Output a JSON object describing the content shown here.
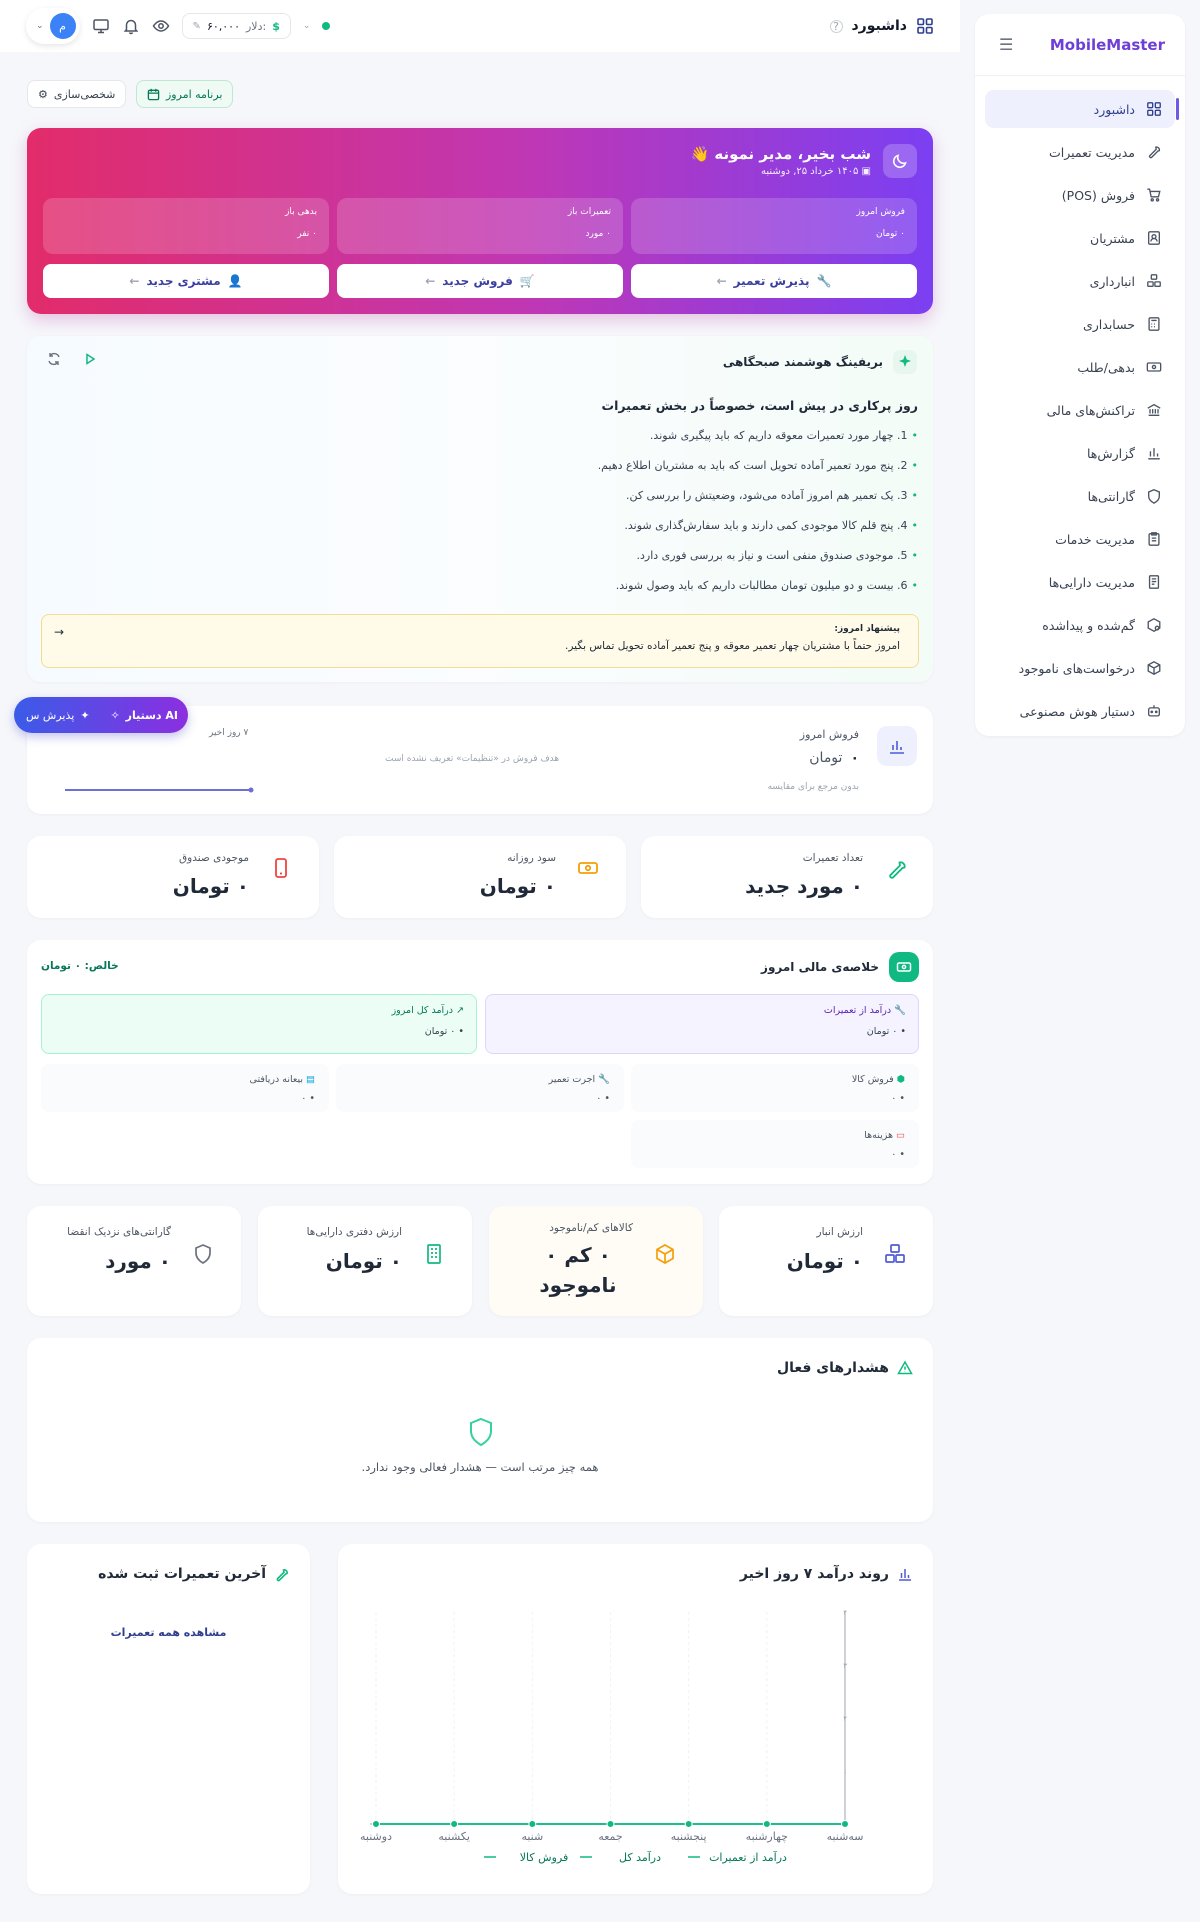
{
  "sidebar": {
    "brand": "MobileMaster",
    "items": [
      {
        "label": "داشبورد",
        "icon": "dashboard-icon",
        "active": true
      },
      {
        "label": "مدیریت تعمیرات",
        "icon": "wrench-icon"
      },
      {
        "label": "فروش (POS)",
        "icon": "cart-icon"
      },
      {
        "label": "مشتریان",
        "icon": "contacts-icon"
      },
      {
        "label": "انبارداری",
        "icon": "boxes-icon"
      },
      {
        "label": "حسابداری",
        "icon": "calculator-icon"
      },
      {
        "label": "بدهی/طلب",
        "icon": "money-icon"
      },
      {
        "label": "تراکنش‌های مالی",
        "icon": "bank-icon"
      },
      {
        "label": "گزارش‌ها",
        "icon": "report-icon"
      },
      {
        "label": "گارانتی‌ها",
        "icon": "shield-icon"
      },
      {
        "label": "مدیریت خدمات",
        "icon": "clipboard-icon"
      },
      {
        "label": "مدیریت دارایی‌ها",
        "icon": "asset-icon"
      },
      {
        "label": "گم‌شده و پیداشده",
        "icon": "lost-found-icon"
      },
      {
        "label": "درخواست‌های ناموجود",
        "icon": "box-request-icon"
      },
      {
        "label": "دستیار هوش مصنوعی",
        "icon": "robot-icon"
      }
    ]
  },
  "header": {
    "title": "داشبورد",
    "dollar_label": "دلار:",
    "dollar_value": "۶۰,۰۰۰",
    "avatar_initial": "م"
  },
  "toolbar": {
    "customize": "شخصی‌سازی",
    "today_plan": "برنامه امروز"
  },
  "hero": {
    "greeting": "شب بخیر، مدیر نمونه",
    "wave": "👋",
    "date": "۱۴۰۵ خرداد ۲۵, دوشنبه",
    "stats": [
      {
        "label": "فروش امروز",
        "value": "۰ تومان"
      },
      {
        "label": "تعمیرات باز",
        "value": "۰ مورد"
      },
      {
        "label": "بدهی باز",
        "value": "۰ نفر"
      }
    ],
    "actions": [
      {
        "label": "پذیرش تعمیر"
      },
      {
        "label": "فروش جدید"
      },
      {
        "label": "مشتری جدید"
      }
    ]
  },
  "briefing": {
    "title": "بریفینگ هوشمند صبحگاهی",
    "heading": "روز پرکاری در پیش است، خصوصاً در بخش تعمیرات",
    "items": [
      "1. چهار مورد تعمیرات معوقه داریم که باید پیگیری شوند.",
      "2. پنج مورد تعمیر آماده تحویل است که باید به مشتریان اطلاع دهیم.",
      "3. یک تعمیر هم امروز آماده می‌شود، وضعیتش را بررسی کن.",
      "4. پنج قلم کالا موجودی کمی دارند و باید سفارش‌گذاری شوند.",
      "5. موجودی صندوق منفی است و نیاز به بررسی فوری دارد.",
      "6. بیست و دو میلیون تومان مطالبات داریم که باید وصول شوند."
    ],
    "suggest_title": "پیشنهاد امروز:",
    "suggest_text": "امروز حتماً با مشتریان چهار تعمیر معوقه و پنج تعمیر آماده تحویل تماس بگیر."
  },
  "ai": {
    "label": "دستیار AI",
    "quick": "پذیرش س"
  },
  "sales_card": {
    "title": "فروش امروز",
    "value": "۰",
    "unit": "تومان",
    "note": "بدون مرجع برای مقایسه",
    "goal_note": "هدف فروش در «تنظیمات» تعریف نشده است",
    "range": "۷ روز اخیر"
  },
  "kpis": [
    {
      "label": "تعداد تعمیرات",
      "value": "۰ مورد جدید"
    },
    {
      "label": "سود روزانه",
      "value": "۰ تومان"
    },
    {
      "label": "موجودی صندوق",
      "value": "۰ تومان"
    }
  ],
  "finance": {
    "title": "خلاصه‌ی مالی امروز",
    "net": "خالص: ۰ تومان",
    "repair_income": {
      "label": "درآمد از تعمیرات",
      "value": "۰ تومان"
    },
    "total_income": {
      "label": "درآمد کل امروز",
      "value": "۰ تومان"
    },
    "cells": [
      {
        "label": "فروش کالا",
        "value": "۰"
      },
      {
        "label": "اجرت تعمیر",
        "value": "۰"
      },
      {
        "label": "بیعانه دریافتی",
        "value": "۰"
      },
      {
        "label": "هزینه‌ها",
        "value": "۰"
      }
    ]
  },
  "inventory": [
    {
      "label": "ارزش انبار",
      "value": "۰ تومان"
    },
    {
      "label": "کالاهای کم/ناموجود",
      "value": "۰ کم ۰ ناموجود"
    },
    {
      "label": "ارزش دفتری دارایی‌ها",
      "value": "۰ تومان"
    },
    {
      "label": "گارانتی‌های نزدیک انقضا",
      "value": "۰ مورد"
    }
  ],
  "alerts": {
    "title": "هشدارهای فعال",
    "empty": "همه چیز مرتب است — هشدار فعالی وجود ندارد."
  },
  "recent": {
    "title": "آخرین تعمیرات ثبت شده",
    "link": "مشاهده همه تعمیرات"
  },
  "chart_data": {
    "type": "line",
    "title": "روند درآمد ۷ روز اخیر",
    "categories": [
      "سه‌شنبه",
      "چهارشنبه",
      "پنجشنبه",
      "جمعه",
      "شنبه",
      "یکشنبه",
      "دوشنبه"
    ],
    "series": [
      {
        "name": "درآمد از تعمیرات",
        "values": [
          0,
          0,
          0,
          0,
          0,
          0,
          0
        ],
        "color": "#10b981"
      },
      {
        "name": "درآمد کل",
        "values": [
          0,
          0,
          0,
          0,
          0,
          0,
          0
        ],
        "color": "#10b981"
      },
      {
        "name": "فروش کالا",
        "values": [
          0,
          0,
          0,
          0,
          0,
          0,
          0
        ],
        "color": "#10b981"
      }
    ],
    "y_ticks": [
      "۴",
      "۳",
      "۲",
      "۱"
    ],
    "ylim": [
      0,
      4
    ],
    "legend": "bottom"
  }
}
